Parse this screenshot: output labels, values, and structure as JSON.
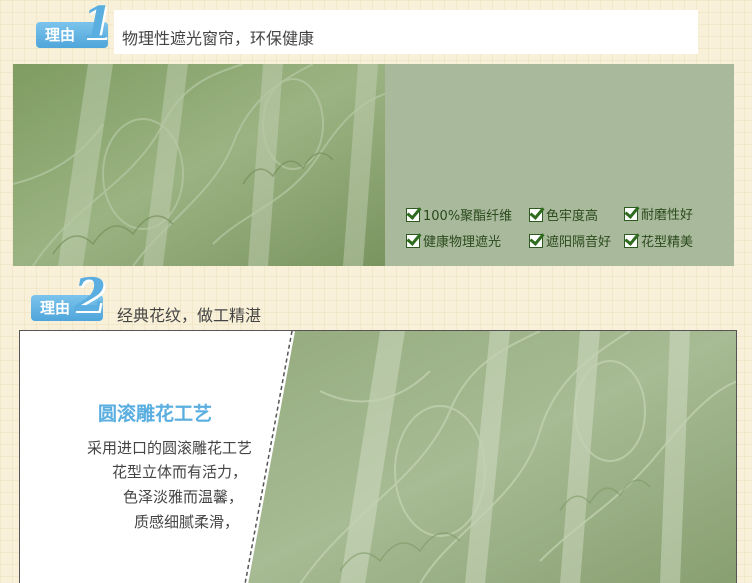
{
  "reason1": {
    "badge_label": "理由",
    "badge_number": "1",
    "title": "物理性遮光窗帘，环保健康",
    "features": [
      "100%聚酯纤维",
      "色牢度高",
      "耐磨性好",
      "健康物理遮光",
      "遮阳隔音好",
      "花型精美"
    ]
  },
  "reason2": {
    "badge_label": "理由",
    "badge_number": "2",
    "title": "经典花纹，做工精湛",
    "craft_title": "圆滚雕花工艺",
    "craft_lines": [
      "采用进口的圆滚雕花工艺",
      "花型立体而有活力，",
      "色泽淡雅而温馨，",
      "质感细腻柔滑，"
    ]
  },
  "colors": {
    "accent_blue": "#5aaee0",
    "fabric_green": "#8da66e",
    "panel_sage": "#a9b99c"
  },
  "icons": [
    "checkbox-check-icon"
  ]
}
